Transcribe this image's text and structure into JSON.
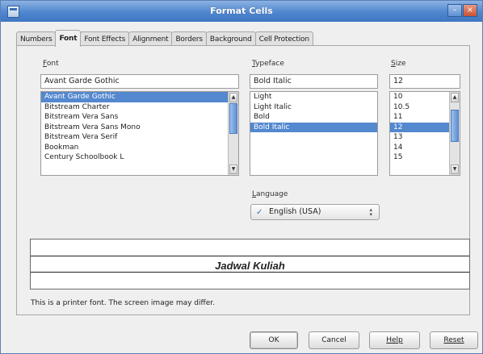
{
  "window": {
    "title": "Format Cells",
    "minimize_glyph": "–",
    "close_glyph": "×"
  },
  "tabs": [
    {
      "label": "Numbers"
    },
    {
      "label": "Font"
    },
    {
      "label": "Font Effects"
    },
    {
      "label": "Alignment"
    },
    {
      "label": "Borders"
    },
    {
      "label": "Background"
    },
    {
      "label": "Cell Protection"
    }
  ],
  "active_tab": "Font",
  "font": {
    "label_mnemonic": "F",
    "label_rest": "ont",
    "value": "Avant Garde Gothic",
    "items": [
      "Avant Garde Gothic",
      "Bitstream Charter",
      "Bitstream Vera Sans",
      "Bitstream Vera Sans Mono",
      "Bitstream Vera Serif",
      "Bookman",
      "Century Schoolbook L"
    ],
    "selected_index": 0
  },
  "typeface": {
    "label_mnemonic": "T",
    "label_rest": "ypeface",
    "value": "Bold Italic",
    "items": [
      "Light",
      "Light Italic",
      "Bold",
      "Bold Italic"
    ],
    "selected_index": 3
  },
  "size": {
    "label_mnemonic": "S",
    "label_rest": "ize",
    "value": "12",
    "items": [
      "10",
      "10.5",
      "11",
      "12",
      "13",
      "14",
      "15"
    ],
    "selected_index": 3
  },
  "language": {
    "label_mnemonic": "L",
    "label_rest": "anguage",
    "value": "English (USA)",
    "icon": "spell-check-icon"
  },
  "preview": {
    "text": "Jadwal Kuliah"
  },
  "note": "This is a printer font. The screen image may differ.",
  "buttons": {
    "ok": "OK",
    "cancel": "Cancel",
    "help": "Help",
    "reset": "Reset"
  },
  "colors": {
    "selection": "#5488cf",
    "titlebar": "#4f86cf"
  }
}
